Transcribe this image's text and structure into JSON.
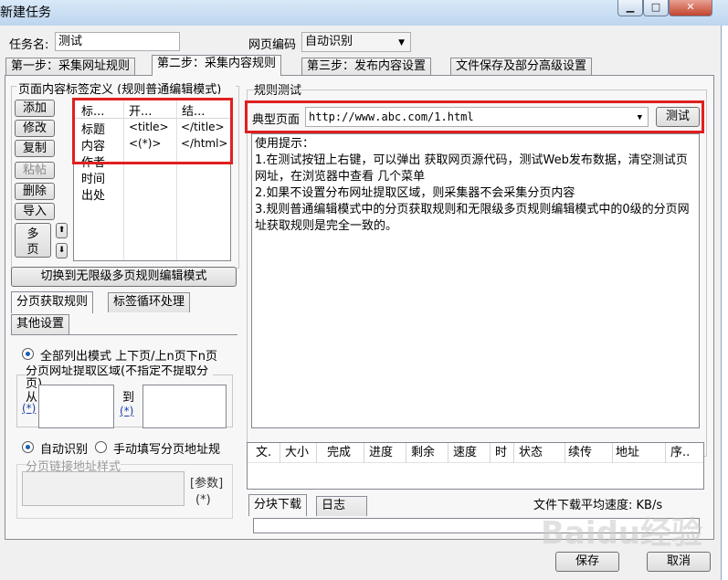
{
  "window": {
    "title": "新建任务",
    "min": "▁",
    "max": "□",
    "close": "✕"
  },
  "task_name": {
    "label": "任务名:",
    "value": "测试"
  },
  "encoding": {
    "label": "网页编码",
    "value": "自动识别"
  },
  "tabs": [
    {
      "label": "第一步：采集网址规则"
    },
    {
      "label": "第二步：采集内容规则"
    },
    {
      "label": "第三步：发布内容设置"
    },
    {
      "label": "文件保存及部分高级设置"
    }
  ],
  "left": {
    "section_title": "页面内容标签定义  (规则普通编辑模式)",
    "buttons": [
      "添加",
      "修改",
      "复制",
      "粘帖",
      "删除",
      "导入",
      "多页"
    ],
    "table": {
      "headers": [
        "标...",
        "开...",
        "结..."
      ],
      "rows": [
        [
          "标题",
          "<title>",
          "</title>"
        ],
        [
          "内容",
          "<(*)>",
          "</html>"
        ],
        [
          "作者",
          "",
          ""
        ],
        [
          "时间",
          "",
          ""
        ],
        [
          "出处",
          "",
          ""
        ]
      ]
    },
    "switch_button": "切换到无限级多页规则编辑模式",
    "sub_tabs": [
      "分页获取规则",
      "标签循环处理",
      "其他设置"
    ],
    "radio_all": "全部列出模式  上下页/上n页下n页",
    "region_label": "分页网址提取区域(不指定不提取分页)",
    "from_label": "从",
    "to_label": "到",
    "wildcard": "(*)",
    "radio_auto": "自动识别",
    "radio_manual": "手动填写分页地址规",
    "pattern_label": "分页链接地址样式",
    "param_label": "[参数]",
    "param_wildcard": "(*)"
  },
  "right": {
    "section_title": "规则测试",
    "page_label": "典型页面",
    "url": "http://www.abc.com/1.html",
    "test_button": "测试",
    "hints": [
      "使用提示：",
      "1.在测试按钮上右键，可以弹出 获取网页源代码，测试Web发布数据，清空测试页网址，在浏览器中查看 几个菜单",
      "2.如果不设置分布网址提取区域，则采集器不会采集分页内容",
      "3.规则普通编辑模式中的分页获取规则和无限级多页规则编辑模式中的0级的分页网址获取规则是完全一致的。"
    ],
    "download_columns": [
      "文.",
      "大小",
      "完成",
      "进度",
      "剩余",
      "速度",
      "时",
      "状态",
      "续传",
      "地址",
      "序.."
    ],
    "bottom_tabs": [
      "分块下载",
      "日志"
    ],
    "speed_label": "文件下载平均速度: KB/s"
  },
  "footer": {
    "save": "保存",
    "cancel": "取消"
  },
  "watermark": "Baidu经验"
}
